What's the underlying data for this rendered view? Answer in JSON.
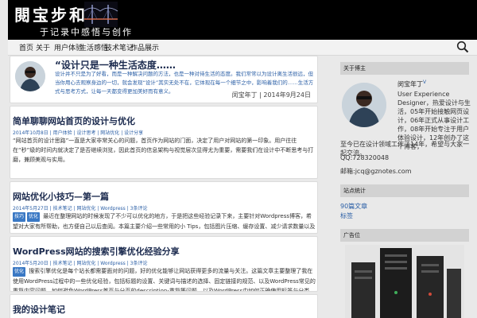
{
  "header": {
    "logo_title": "閱宝步和",
    "logo_subtitle": "于记录中感悟与创作"
  },
  "nav": {
    "items": [
      "首页",
      "关于",
      "用户体验",
      "生活感悟",
      "技术笔记",
      "作品展示"
    ]
  },
  "quote": {
    "title": "“设计只是一种生活态度……",
    "text": "设计并不只是为了好看，而是一种解决问题的方法，也是一种对待生活的态度。我们常常以为设计离生活很远，但当你用心去观察身边的一切，就会发现“设计”其实无处不在，它体现在每一个细节之中，影响着我们的……生活方式与思考方式，让每一天都变得更加美好而有意义。",
    "author": "闵宝年丁",
    "date": "2014年9月24日"
  },
  "posts": [
    {
      "title": "简单聊聊网站首页的设计与优化",
      "date": "2014年10月8日",
      "meta": [
        "用户体验",
        "设计思考",
        "网站优化",
        "设计分享"
      ],
      "tags": [],
      "excerpt": "“网站首页的设计思路”一直是大家非常关心的问题，首页作为网站的门面，决定了用户对网站的第一印象。用户往往在“秒”级的时间内就决定了是否继续浏览，因此首页的信息架构与视觉层次显得尤为重要，需要我们在设计中不断思考与打磨，兼顾美观与实用。",
      "more": ""
    },
    {
      "title": "网站优化小技巧—第一篇",
      "date": "2014年5月27日",
      "meta": [
        "技术笔记",
        "网站优化",
        "Wordpress",
        "3条评论"
      ],
      "tags": [
        "技巧",
        "优化"
      ],
      "excerpt": "最近在整理网站的时候发现了不少可以优化的地方，于是把这些经验记录下来，主要针对Wordpress博客，希望对大家有所帮助，也方便自己以后查阅。本篇主要介绍一些常用的小 Tips，包括图片压缩、缓存设置、减少请求数量以及合理使用Ajax等方法，能够在一定程度上提升页面的加载速度与用户体验 继续阅读 »",
      "more": ""
    },
    {
      "title": "WordPress网站的搜索引擎优化经验分享",
      "date": "2014年5月20日",
      "meta": [
        "技术笔记",
        "网站优化",
        "Wordpress",
        "3条评论"
      ],
      "tags": [
        "优化"
      ],
      "excerpt": "搜索引擎优化是每个站长都需要面对的问题，好的优化能够让网站获得更多的流量与关注。这篇文章主要整理了我在使用WordPress过程中的一些优化经验，包括标题的设置、关键词与描述的选择、固定链接的规范、以及WordPress常见的重复内容问题—如何避免WordPress首页与分页的description-重复等问题，以及WordPress中如何正确使用标签与分类—如何使用canonical标签避免重复收录等内容，希望对大家有所帮助。",
      "more": ""
    },
    {
      "title": "我的设计笔记",
      "date": "",
      "meta": [],
      "tags": [],
      "excerpt": "",
      "more": ""
    }
  ],
  "sidebar": {
    "profile_head": "关于博主",
    "profile_name": "闵宝年丁",
    "profile_badge": "V",
    "profile_bio": "User Experience Designer，热爱设计与生活，05年开始接触网页设计，06年正式从事设计工作，08年开始专注于用户体验设计，12年创办了这个博客，",
    "profile_bio_tail": "至今已在设计领域工作了14年，希望与大家一起交流。",
    "profile_qq": "QQ:728320048",
    "profile_email": "邮箱:jcq@gznotes.com",
    "stats_head": "站点统计",
    "stats_lines": [
      "90篇文章",
      "标签"
    ],
    "ad_head": "广告位"
  },
  "colors": {
    "link": "#2b5fa6",
    "title": "#1b2a4e",
    "banner": "#000000",
    "widget_head": "#d2d2d2"
  },
  "icons": {
    "search": "search-icon",
    "badge": "verified-badge-icon"
  }
}
